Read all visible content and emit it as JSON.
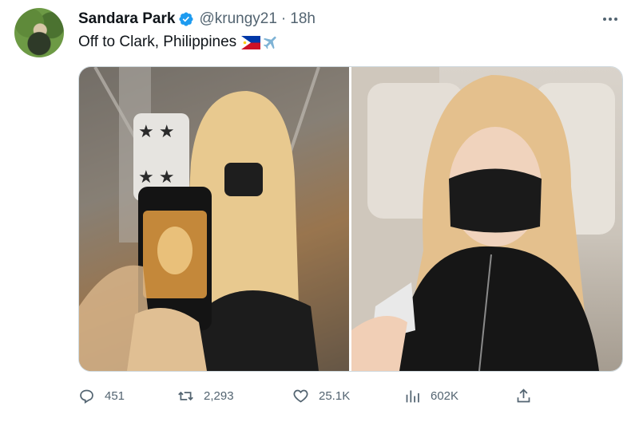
{
  "tweet": {
    "author": {
      "name": "Sandara Park",
      "handle": "@krungy21",
      "verified": true
    },
    "separator": "·",
    "time": "18h",
    "text": "Off to Clark, Philippines",
    "emoji": [
      "philippines-flag",
      "airplane"
    ],
    "media_count": 2,
    "stats": {
      "replies": "451",
      "retweets": "2,293",
      "likes": "25.1K",
      "views": "602K"
    }
  },
  "colors": {
    "text_primary": "#0f1419",
    "text_secondary": "#536471",
    "verified_badge": "#1d9bf0",
    "border": "#cfd9de"
  },
  "icons": [
    "more-icon",
    "verified-badge-icon",
    "reply-icon",
    "retweet-icon",
    "like-icon",
    "views-icon",
    "share-icon"
  ]
}
